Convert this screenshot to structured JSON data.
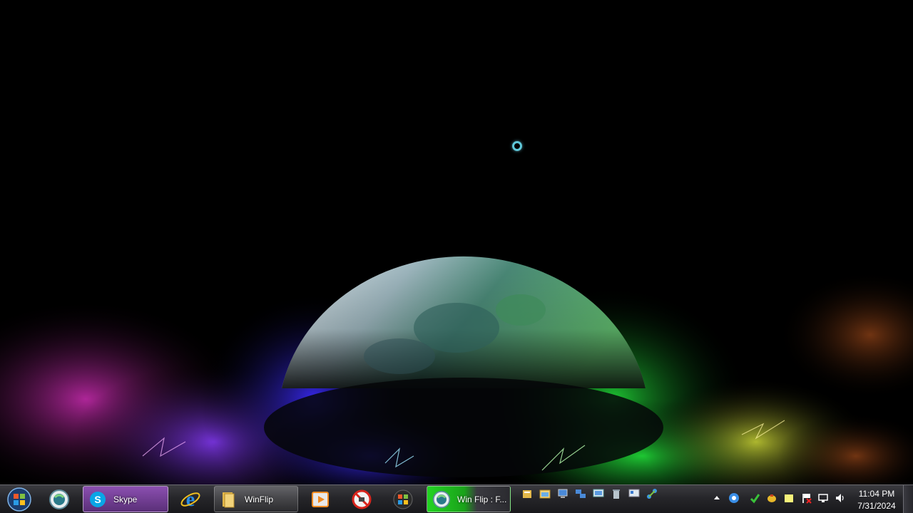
{
  "taskbar": {
    "buttons": [
      {
        "id": "skype",
        "label": "Skype",
        "icon": "skype-icon"
      },
      {
        "id": "winflip-folder",
        "label": "WinFlip",
        "icon": "folder-icon"
      },
      {
        "id": "winflip-window",
        "label": "Win Flip : F...",
        "icon": "winflip-icon"
      }
    ],
    "pinned": [
      {
        "id": "winflip-app",
        "icon": "winflip-globe-icon"
      },
      {
        "id": "internet-explorer",
        "icon": "ie-icon"
      },
      {
        "id": "media-player",
        "icon": "media-player-icon"
      },
      {
        "id": "blocked-app",
        "icon": "no-entry-icon"
      },
      {
        "id": "windows-logo",
        "icon": "windows-flag-icon"
      }
    ],
    "quick_launch": [
      "folder-small-icon",
      "explorer-icon",
      "computer-icon",
      "network-icon",
      "monitor-icon",
      "bin-icon",
      "display-icon",
      "connections-icon"
    ],
    "tray": [
      "expand-tray-icon",
      "browser-tray-icon",
      "security-tray-icon",
      "antivirus-tray-icon",
      "notes-tray-icon",
      "flag-tray-icon",
      "network-tray-icon",
      "volume-icon"
    ],
    "clock": {
      "time": "11:04 PM",
      "date": "7/31/2024"
    }
  },
  "colors": {
    "taskbar_bg": "#26262a",
    "active_button": "#5a2f78",
    "green_button": "#23d323",
    "cursor_ring": "#5fc7d8"
  }
}
